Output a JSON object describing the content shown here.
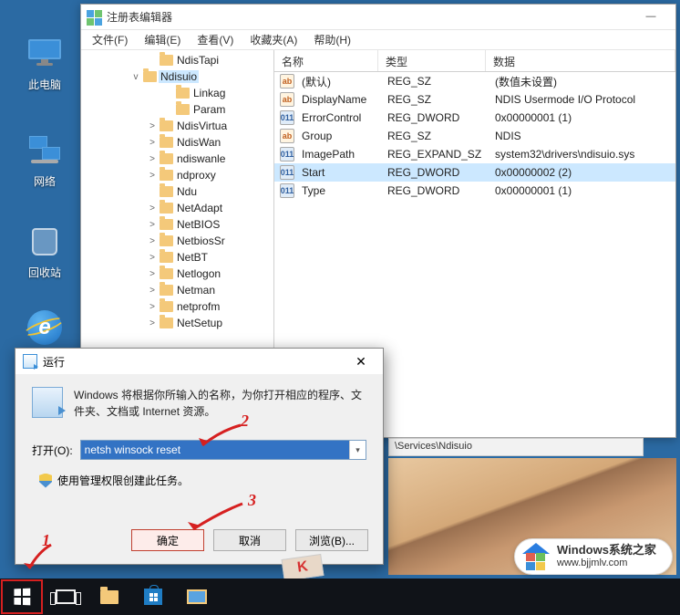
{
  "desktop": {
    "this_pc": "此电脑",
    "network": "网络",
    "recycle_bin": "回收站"
  },
  "regedit": {
    "title": "注册表编辑器",
    "menu": {
      "file": "文件(F)",
      "edit": "编辑(E)",
      "view": "查看(V)",
      "fav": "收藏夹(A)",
      "help": "帮助(H)"
    },
    "tree": [
      {
        "lvl": 1,
        "exp": "",
        "t": "NdisTapi"
      },
      {
        "lvl": 0,
        "exp": "v",
        "t": "Ndisuio",
        "sel": true
      },
      {
        "lvl": 2,
        "exp": "",
        "t": "Linkag"
      },
      {
        "lvl": 2,
        "exp": "",
        "t": "Param"
      },
      {
        "lvl": 1,
        "exp": ">",
        "t": "NdisVirtua"
      },
      {
        "lvl": 1,
        "exp": ">",
        "t": "NdisWan"
      },
      {
        "lvl": 1,
        "exp": ">",
        "t": "ndiswanle"
      },
      {
        "lvl": 1,
        "exp": ">",
        "t": "ndproxy"
      },
      {
        "lvl": 1,
        "exp": "",
        "t": "Ndu"
      },
      {
        "lvl": 1,
        "exp": ">",
        "t": "NetAdapt"
      },
      {
        "lvl": 1,
        "exp": ">",
        "t": "NetBIOS"
      },
      {
        "lvl": 1,
        "exp": ">",
        "t": "NetbiosSr"
      },
      {
        "lvl": 1,
        "exp": ">",
        "t": "NetBT"
      },
      {
        "lvl": 1,
        "exp": ">",
        "t": "Netlogon"
      },
      {
        "lvl": 1,
        "exp": ">",
        "t": "Netman"
      },
      {
        "lvl": 1,
        "exp": ">",
        "t": "netprofm"
      },
      {
        "lvl": 1,
        "exp": ">",
        "t": "NetSetup"
      }
    ],
    "cols": {
      "name": "名称",
      "type": "类型",
      "data": "数据"
    },
    "rows": [
      {
        "i": "str",
        "n": "(默认)",
        "t": "REG_SZ",
        "d": "(数值未设置)"
      },
      {
        "i": "str",
        "n": "DisplayName",
        "t": "REG_SZ",
        "d": "NDIS Usermode I/O Protocol"
      },
      {
        "i": "bin",
        "n": "ErrorControl",
        "t": "REG_DWORD",
        "d": "0x00000001 (1)"
      },
      {
        "i": "str",
        "n": "Group",
        "t": "REG_SZ",
        "d": "NDIS"
      },
      {
        "i": "bin",
        "n": "ImagePath",
        "t": "REG_EXPAND_SZ",
        "d": "system32\\drivers\\ndisuio.sys"
      },
      {
        "i": "bin",
        "n": "Start",
        "t": "REG_DWORD",
        "d": "0x00000002 (2)",
        "sel": true
      },
      {
        "i": "bin",
        "n": "Type",
        "t": "REG_DWORD",
        "d": "0x00000001 (1)"
      }
    ],
    "statusbar": "\\Services\\Ndisuio"
  },
  "run": {
    "title": "运行",
    "desc": "Windows 将根据你所输入的名称，为你打开相应的程序、文件夹、文档或 Internet 资源。",
    "open_label": "打开(O):",
    "value": "netsh winsock reset",
    "admin_note": "使用管理权限创建此任务。",
    "ok": "确定",
    "cancel": "取消",
    "browse": "浏览(B)..."
  },
  "annotations": {
    "a1": "1",
    "a2": "2",
    "a3": "3"
  },
  "badge": {
    "t1": "Windows系统之家",
    "t2": "www.bjjmlv.com"
  }
}
